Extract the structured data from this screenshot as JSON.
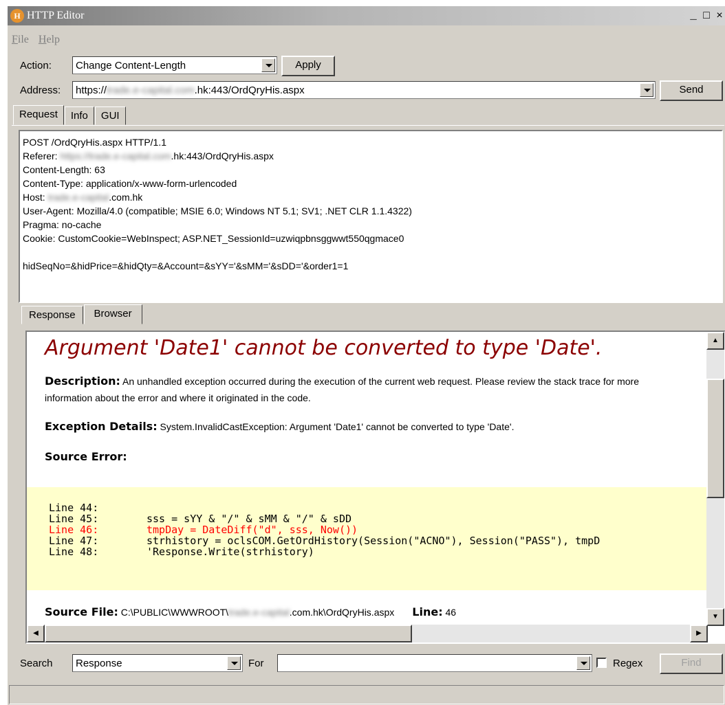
{
  "window": {
    "title": "HTTP Editor",
    "app_icon": "H",
    "controls": {
      "minimize": "_",
      "maximize": "□",
      "close": "×"
    }
  },
  "menu": [
    "File",
    "Help"
  ],
  "action": {
    "label": "Action:",
    "value": "Change Content-Length",
    "apply_label": "Apply"
  },
  "address": {
    "label": "Address:",
    "prefix": "https://",
    "blurred": "trade.e-capital.com",
    "suffix": ".hk:443/OrdQryHis.aspx",
    "send_label": "Send"
  },
  "request_tabs": [
    "Request",
    "Info",
    "GUI"
  ],
  "request": {
    "line1": "POST /OrdQryHis.aspx HTTP/1.1",
    "referer_prefix": "Referer: ",
    "referer_blurred": "https://trade.e-capital.com",
    "referer_suffix": ".hk:443/OrdQryHis.aspx",
    "content_length": "Content-Length: 63",
    "content_type": "Content-Type: application/x-www-form-urlencoded",
    "host_prefix": "Host: ",
    "host_blurred": "trade.e-capital",
    "host_suffix": ".com.hk",
    "user_agent": "User-Agent: Mozilla/4.0 (compatible; MSIE 6.0; Windows NT 5.1; SV1; .NET CLR 1.1.4322)",
    "pragma": "Pragma: no-cache",
    "cookie": "Cookie: CustomCookie=WebInspect; ASP.NET_SessionId=uzwiqpbnsggwwt550qgmace0",
    "body": "hidSeqNo=&hidPrice=&hidQty=&Account=&sYY='&sMM='&sDD='&order1=1"
  },
  "response_tabs": [
    "Response",
    "Browser"
  ],
  "response": {
    "title": "Argument 'Date1' cannot be converted to type 'Date'.",
    "description_label": "Description:",
    "description_text": " An unhandled exception occurred during the execution of the current web request. Please review the stack trace for more information about the error and where it originated in the code.",
    "exception_label": "Exception Details:",
    "exception_text": " System.InvalidCastException: Argument 'Date1' cannot be converted to type 'Date'.",
    "source_error_label": "Source Error:",
    "code_lines": [
      {
        "line": "Line 44:",
        "code": ""
      },
      {
        "line": "Line 45:",
        "code": "sss = sYY & \"/\" & sMM & \"/\" & sDD"
      },
      {
        "line": "Line 46:",
        "code": "tmpDay = DateDiff(\"d\", sss, Now())"
      },
      {
        "line": "Line 47:",
        "code": "strhistory = oclsCOM.GetOrdHistory(Session(\"ACNO\"), Session(\"PASS\"), tmpD"
      },
      {
        "line": "Line 48:",
        "code": "'Response.Write(strhistory)"
      }
    ],
    "source_file_label": "Source File:",
    "source_file_prefix": " C:\\PUBLIC\\WWWROOT\\",
    "source_file_blurred": "trade.e-capital",
    "source_file_suffix": ".com.hk\\OrdQryHis.aspx",
    "line_label": "Line:",
    "line_value": " 46"
  },
  "search": {
    "label": "Search",
    "value": "Response",
    "for_label": "For",
    "for_value": "",
    "regex_label": "Regex",
    "find_label": "Find"
  },
  "colors": {
    "error_title": "#8b0000",
    "error_line": "#ff0000",
    "code_bg": "#ffffcc",
    "chrome": "#d4d0c8"
  }
}
